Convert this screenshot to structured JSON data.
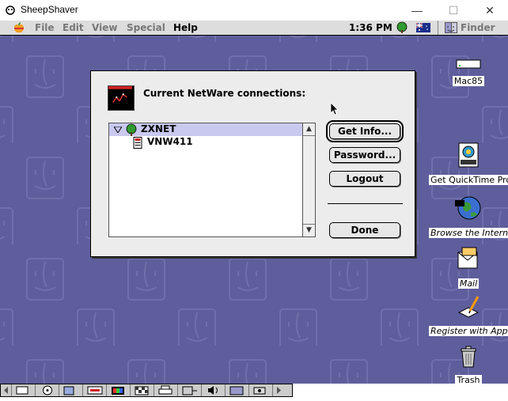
{
  "window": {
    "title": "SheepShaver",
    "controls": {
      "minimize": "—",
      "maximize": "☐",
      "close": "✕"
    }
  },
  "menubar": {
    "items": [
      "File",
      "Edit",
      "View",
      "Special",
      "Help"
    ],
    "clock": "1:36 PM",
    "app": "Finder"
  },
  "dialog": {
    "title": "Current NetWare connections:",
    "list": [
      {
        "label": "ZXNET",
        "icon": "tree-icon",
        "expanded": true,
        "selected": true
      },
      {
        "label": "VNW411",
        "icon": "server-icon",
        "selected": false
      }
    ],
    "buttons": {
      "get_info": "Get Info...",
      "password": "Password...",
      "logout": "Logout",
      "done": "Done"
    }
  },
  "desktop_icons": [
    {
      "label": "Mac85"
    },
    {
      "label": "Get QuickTime Pro"
    },
    {
      "label": "Browse the Internet"
    },
    {
      "label": "Mail"
    },
    {
      "label": "Register with Apple"
    },
    {
      "label": "Trash"
    }
  ],
  "colors": {
    "desktop": "#5e5e9c",
    "selection": "#c9c9ef",
    "menubar": "#dddddd"
  }
}
